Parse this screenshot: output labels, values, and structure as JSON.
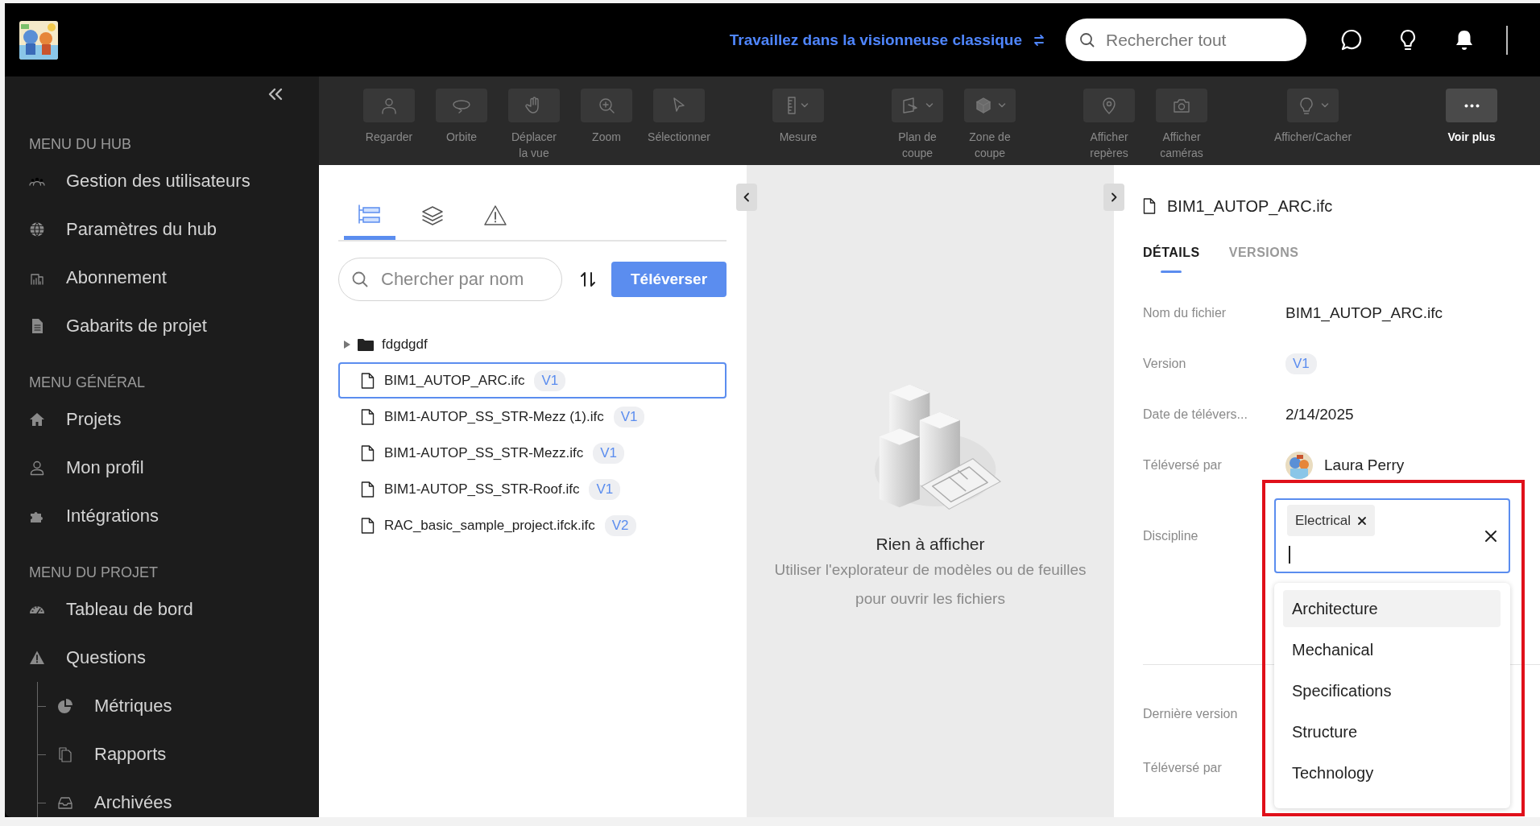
{
  "topbar": {
    "classic_link": "Travaillez dans la visionneuse classique",
    "search": {
      "placeholder": "Rechercher tout"
    }
  },
  "sidebar": {
    "sections": [
      {
        "title": "MENU DU HUB",
        "items": [
          {
            "label": "Gestion des utilisateurs"
          },
          {
            "label": "Paramètres du hub"
          },
          {
            "label": "Abonnement"
          },
          {
            "label": "Gabarits de projet"
          }
        ]
      },
      {
        "title": "MENU GÉNÉRAL",
        "items": [
          {
            "label": "Projets"
          },
          {
            "label": "Mon profil"
          },
          {
            "label": "Intégrations"
          }
        ]
      },
      {
        "title": "MENU DU PROJET",
        "items": [
          {
            "label": "Tableau de bord"
          },
          {
            "label": "Questions",
            "expanded": true,
            "children": [
              {
                "label": "Métriques"
              },
              {
                "label": "Rapports"
              },
              {
                "label": "Archivées"
              }
            ]
          }
        ]
      }
    ]
  },
  "toolbar": {
    "groups": [
      [
        {
          "label": "Regarder",
          "disabled": true,
          "dropdown": false
        },
        {
          "label": "Orbite",
          "disabled": true,
          "dropdown": false
        },
        {
          "label": "Déplacer\nla vue",
          "disabled": true,
          "dropdown": false
        },
        {
          "label": "Zoom",
          "disabled": true,
          "dropdown": false
        },
        {
          "label": "Sélectionner",
          "disabled": true,
          "dropdown": false
        }
      ],
      [
        {
          "label": "Mesure",
          "disabled": true,
          "dropdown": true
        }
      ],
      [
        {
          "label": "Plan de\ncoupe",
          "disabled": true,
          "dropdown": true
        },
        {
          "label": "Zone de\ncoupe",
          "disabled": true,
          "dropdown": true
        }
      ],
      [
        {
          "label": "Afficher\nrepères",
          "disabled": true,
          "dropdown": false
        },
        {
          "label": "Afficher\ncaméras",
          "disabled": true,
          "dropdown": false
        }
      ],
      [
        {
          "label": "Afficher/Cacher",
          "disabled": true,
          "dropdown": true
        }
      ],
      [
        {
          "label": "Voir plus",
          "disabled": false,
          "dropdown": false
        }
      ]
    ]
  },
  "browser": {
    "tabs": [
      {
        "selected": true
      },
      {
        "selected": false
      },
      {
        "selected": false
      }
    ],
    "search": {
      "placeholder": "Chercher par nom"
    },
    "upload_button": "Téléverser",
    "tree": [
      {
        "kind": "folder",
        "name": "fdgdgdf",
        "expanded": false,
        "selected": false
      },
      {
        "kind": "file",
        "name": "BIM1_AUTOP_ARC.ifc",
        "version": "V1",
        "selected": true
      },
      {
        "kind": "file",
        "name": "BIM1-AUTOP_SS_STR-Mezz (1).ifc",
        "version": "V1",
        "selected": false
      },
      {
        "kind": "file",
        "name": "BIM1-AUTOP_SS_STR-Mezz.ifc",
        "version": "V1",
        "selected": false
      },
      {
        "kind": "file",
        "name": "BIM1-AUTOP_SS_STR-Roof.ifc",
        "version": "V1",
        "selected": false
      },
      {
        "kind": "file",
        "name": "RAC_basic_sample_project.ifck.ifc",
        "version": "V2",
        "selected": false
      }
    ]
  },
  "viewer": {
    "empty_title": "Rien à afficher",
    "empty_message": "Utiliser l'explorateur de modèles ou de feuilles pour ouvrir les fichiers"
  },
  "details": {
    "file_name": "BIM1_AUTOP_ARC.ifc",
    "tabs": [
      {
        "label": "DÉTAILS",
        "selected": true
      },
      {
        "label": "VERSIONS",
        "selected": false
      }
    ],
    "fields": [
      {
        "kind": "text",
        "label": "Nom du fichier",
        "value": "BIM1_AUTOP_ARC.ifc"
      },
      {
        "kind": "badge",
        "label": "Version",
        "value": "V1"
      },
      {
        "kind": "text",
        "label": "Date de télévers...",
        "value": "2/14/2025"
      },
      {
        "kind": "user",
        "label": "Téléversé par",
        "value": "Laura Perry"
      },
      {
        "kind": "multiselect",
        "label": "Discipline",
        "focused": true,
        "tags": [
          {
            "label": "Electrical"
          }
        ],
        "options": [
          {
            "label": "Architecture",
            "highlighted": true
          },
          {
            "label": "Mechanical",
            "highlighted": false
          },
          {
            "label": "Specifications",
            "highlighted": false
          },
          {
            "label": "Structure",
            "highlighted": false
          },
          {
            "label": "Technology",
            "highlighted": false
          }
        ]
      }
    ],
    "version_fields": [
      {
        "label": "Dernière version"
      },
      {
        "label": "Téléversé par"
      }
    ]
  }
}
